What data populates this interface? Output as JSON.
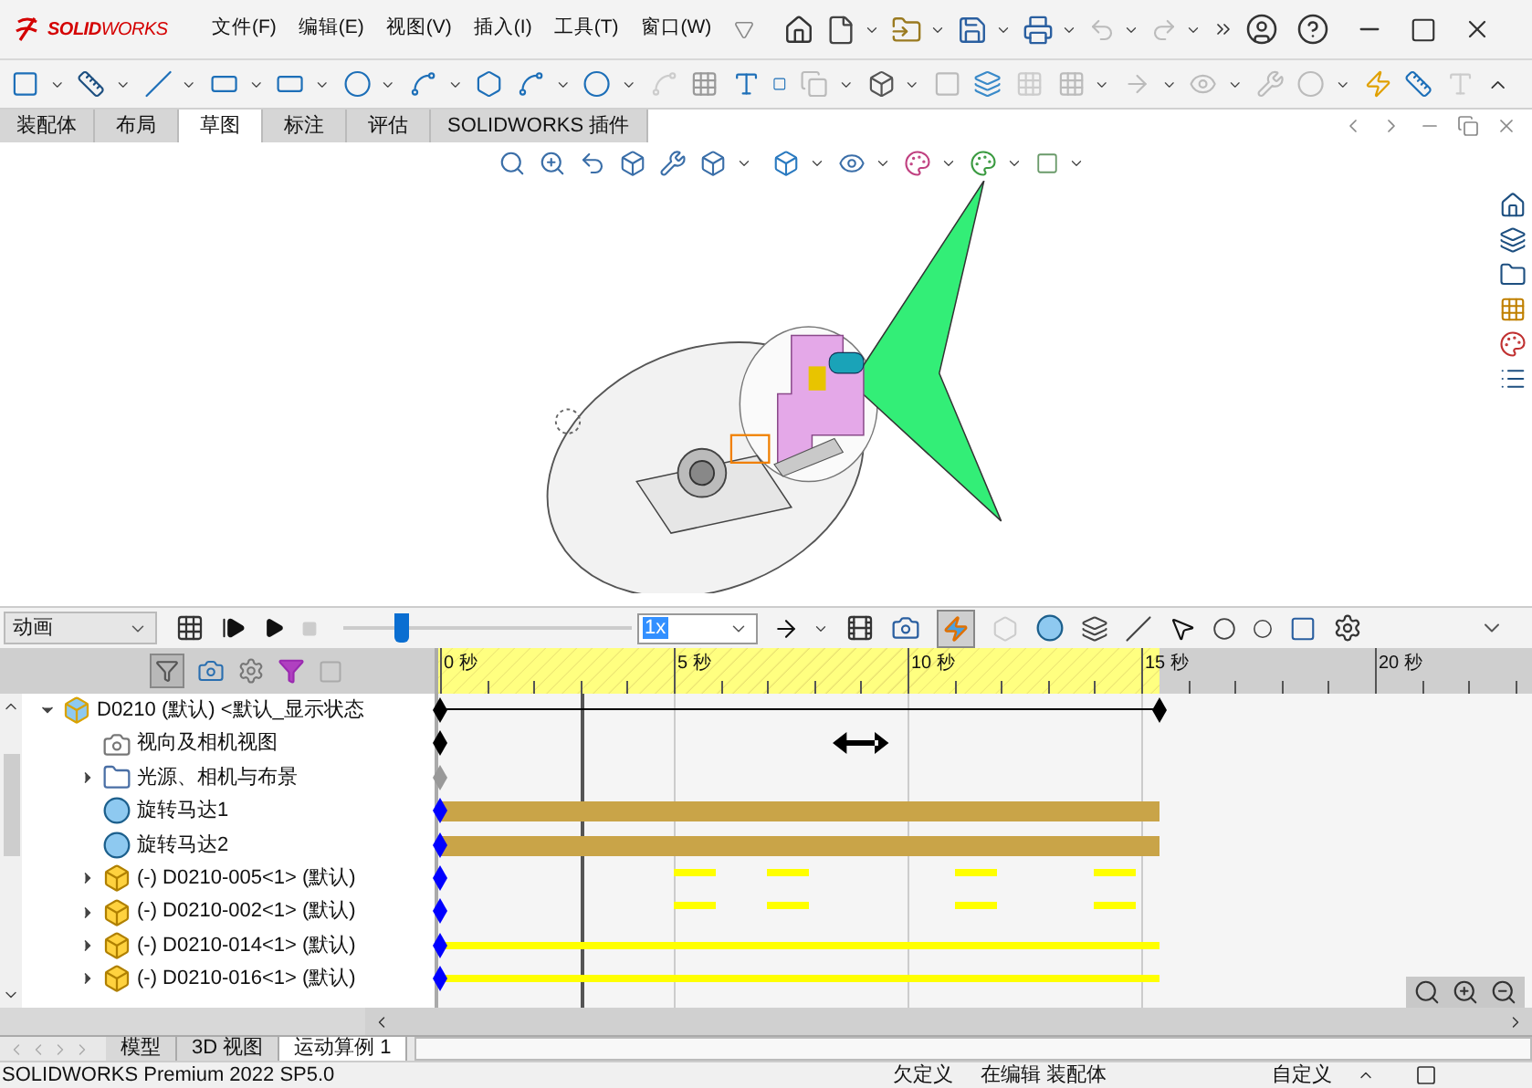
{
  "app": {
    "logo": "**SOLID**WORKS"
  },
  "menu": [
    "文件(F)",
    "编辑(E)",
    "视图(V)",
    "插入(I)",
    "工具(T)",
    "窗口(W)"
  ],
  "command_tabs": [
    {
      "label": "装配体",
      "selected": false
    },
    {
      "label": "布局",
      "selected": false
    },
    {
      "label": "草图",
      "selected": true
    },
    {
      "label": "标注",
      "selected": false
    },
    {
      "label": "评估",
      "selected": false
    },
    {
      "label": "SOLIDWORKS 插件",
      "selected": false
    }
  ],
  "motion_study": {
    "study_type": "动画",
    "slider": {
      "level": 0.2
    },
    "speed": "1x",
    "ruler": [
      "0 秒",
      "5 秒",
      "10 秒",
      "15 秒",
      "20 秒"
    ],
    "tree": [
      {
        "label": "D0210 (默认) <默认_显示状态",
        "kind": "assembly",
        "expanded": true,
        "track": {
          "kind": "span"
        },
        "color": "#000000",
        "children": [
          {
            "label": "视向及相机视图",
            "kind": "camera",
            "track": {
              "kind": "view"
            },
            "color": "#000000"
          },
          {
            "label": "光源、相机与布景",
            "kind": "lights",
            "expanded": false,
            "track": {
              "kind": "static"
            },
            "color": "#999999"
          },
          {
            "label": "旋转马达1",
            "kind": "motor",
            "track": {
              "kind": "motor"
            },
            "color": "#0000ff"
          },
          {
            "label": "旋转马达2",
            "kind": "motor",
            "track": {
              "kind": "motor"
            },
            "color": "#0000ff"
          },
          {
            "label": "(-) D0210-005<1> (默认)",
            "kind": "part",
            "expanded": false,
            "track": {
              "kind": "intermittent"
            },
            "color": "#0000ff"
          },
          {
            "label": "(-) D0210-002<1> (默认)",
            "kind": "part",
            "expanded": false,
            "track": {
              "kind": "intermittent"
            },
            "color": "#0000ff"
          },
          {
            "label": "(-) D0210-014<1> (默认)",
            "kind": "part",
            "expanded": false,
            "track": {
              "kind": "continuous"
            },
            "color": "#0000ff"
          },
          {
            "label": "(-) D0210-016<1> (默认)",
            "kind": "part",
            "expanded": false,
            "track": {
              "kind": "continuous"
            },
            "color": "#0000ff"
          }
        ]
      }
    ]
  },
  "bottom_tabs": [
    {
      "label": "模型",
      "selected": false
    },
    {
      "label": "3D 视图",
      "selected": false
    },
    {
      "label": "运动算例 1",
      "selected": true
    }
  ],
  "status_bar": [
    "SOLIDWORKS Premium 2022 SP5.0",
    "欠定义",
    "在编辑 装配体",
    "自定义"
  ]
}
